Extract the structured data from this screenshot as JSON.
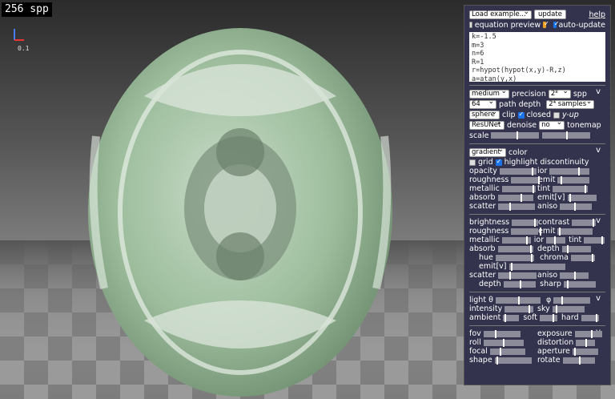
{
  "hud": {
    "spp": "256 spp",
    "axis_value": "0.1"
  },
  "top": {
    "load_example": "Load example...",
    "update": "update",
    "help": "help",
    "equation_preview": "equation preview",
    "auto_update": "auto-update",
    "code_lines": [
      "k=-1.5",
      "m=3",
      "n=6",
      "R=1",
      "r=hypot(hypot(x,y)-R,z)",
      "a=atan(y,x)"
    ]
  },
  "render": {
    "precision_value": "medium",
    "precision_label": "precision",
    "spp_value": "2⁸",
    "spp_label": "spp",
    "depth_value": "64",
    "depth_label": "path depth",
    "samples_value": "2⁴ samples",
    "clip_value": "sphere",
    "clip_label": "clip",
    "closed_label": "closed",
    "yup_label": "y-up",
    "denoise_value": "ResUNet",
    "denoise_label": "denoise",
    "tonemap_value": "no",
    "tonemap_label": "tonemap",
    "scale_label": "scale",
    "collapse": "v"
  },
  "color": {
    "mode_value": "gradient",
    "mode_label": "color",
    "grid_label": "grid",
    "highlight_label": "highlight discontinuity",
    "collapse": "v",
    "pairs": [
      [
        "opacity",
        "ior"
      ],
      [
        "roughness",
        "emit"
      ],
      [
        "metallic",
        "tint"
      ],
      [
        "absorb",
        "emit[v]"
      ],
      [
        "scatter",
        "aniso"
      ]
    ]
  },
  "material": {
    "collapse": "v",
    "rows": [
      [
        "brightness",
        "contrast"
      ],
      [
        "roughness",
        "emit"
      ],
      [
        "metallic",
        "ior",
        "tint"
      ],
      [
        "absorb",
        "depth"
      ],
      [
        "hue",
        "chroma"
      ],
      [
        "emit[v]"
      ],
      [
        "scatter",
        "aniso"
      ],
      [
        "depth",
        "sharp"
      ]
    ]
  },
  "light": {
    "collapse": "v",
    "theta": "light θ",
    "phi": "φ",
    "intensity": "intensity",
    "sky": "sky",
    "ambient": "ambient",
    "soft": "soft",
    "hard": "hard"
  },
  "camera": {
    "collapse": "v",
    "pairs": [
      [
        "fov",
        "exposure"
      ],
      [
        "roll",
        "distortion"
      ],
      [
        "focal",
        "aperture"
      ],
      [
        "shape",
        "rotate"
      ]
    ]
  }
}
